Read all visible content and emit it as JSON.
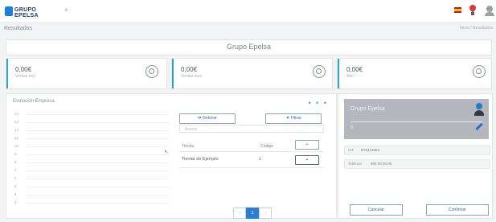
{
  "header": {
    "logo_text": "GRUPO EPELSA",
    "close_glyph": "×",
    "icons": [
      "spain-flag-icon",
      "location-pin-icon",
      "user-icon"
    ]
  },
  "breadcrumb": {
    "page": "Resultados",
    "path": "Inicio / Resultados"
  },
  "page_title": "Grupo Epelsa",
  "stats": [
    {
      "value": "0,00€",
      "label": "Ventas hoy",
      "icon": "chart-circle-icon"
    },
    {
      "value": "0,00€",
      "label": "Ventas mes",
      "icon": "chart-circle-icon"
    },
    {
      "value": "0,00€",
      "label": "Año",
      "icon": "chart-circle-icon"
    }
  ],
  "chart_panel": {
    "title": "Evolución Empresa",
    "menu_glyph": "• • •",
    "y_ticks": [
      "14",
      "13",
      "12",
      "11",
      "10",
      "9",
      "8",
      "7",
      "6",
      "5",
      "4",
      "3"
    ]
  },
  "chart_data": {
    "type": "line",
    "title": "Evolución Empresa",
    "y_ticks": [
      14,
      13,
      12,
      11,
      10,
      9,
      8,
      7,
      6,
      5,
      4,
      3
    ],
    "series": []
  },
  "stores": {
    "order_label": "Ordenar",
    "filter_label": "Filtrar",
    "search_placeholder": "Buscar",
    "columns": [
      "Tienda",
      "Código"
    ],
    "add_glyph": "+",
    "rows": [
      {
        "name": "Tienda de Ejemplo",
        "code": "1",
        "action_glyph": "+"
      }
    ],
    "pagination": [
      "‹",
      "1",
      "›"
    ]
  },
  "company_card": {
    "name": "Grupo Epelsa",
    "sub": "0"
  },
  "company_info": [
    {
      "key": "CIF",
      "value": "B78423653"
    },
    {
      "key": "Teléfono",
      "value": "900 00 00 00"
    }
  ],
  "actions": {
    "cancel_label": "Cancelar",
    "save_label": "Confirmar"
  }
}
